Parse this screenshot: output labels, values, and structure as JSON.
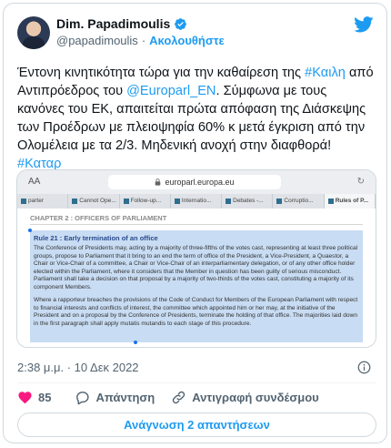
{
  "author": {
    "name": "Dim. Papadimoulis",
    "handle": "@papadimoulis",
    "separator": "·",
    "follow_label": "Ακολουθήστε"
  },
  "tweet": {
    "text_1": "Έντονη κινητικότητα τώρα για την καθαίρεση της ",
    "tag_1": "#Καιλη",
    "text_2": " από Αντιπρόεδρος του ",
    "tag_2": "@Europarl_EN",
    "text_3": ". Σύμφωνα με τους κανόνες του ΕΚ, απαιτείται πρώτα απόφαση της Διάσκεψης των Προέδρων με πλειοψηφία 60% κ μετά έγκριση από την Ολομέλεια με τα 2/3. Μηδενική ανοχή στην διαφθορά! ",
    "tag_3": "#Καταρ"
  },
  "media": {
    "browser": {
      "reader_label": "AA",
      "url": "europarl.europa.eu",
      "tabs": [
        {
          "label": "parter"
        },
        {
          "label": "Cannot Ope..."
        },
        {
          "label": "Follow-up..."
        },
        {
          "label": "Internatio..."
        },
        {
          "label": "Debates -..."
        },
        {
          "label": "Corruptio..."
        },
        {
          "label": "Rules of P..."
        }
      ]
    },
    "document": {
      "chapter": "CHAPTER 2 : OFFICERS OF PARLIAMENT",
      "rule_title": "Rule 21 : Early termination of an office",
      "paragraph_1": "The Conference of Presidents may, acting by a majority of three-fifths of the votes cast, representing at least three political groups, propose to Parliament that it bring to an end the term of office of the President, a Vice-President, a Quaestor, a Chair or Vice-Chair of a committee, a Chair or Vice-Chair of an interparliamentary delegation, or of any other office holder elected within the Parliament, where it considers that the Member in question has been guilty of serious misconduct. Parliament shall take a decision on that proposal by a majority of two-thirds of the votes cast, constituting a majority of its component Members.",
      "paragraph_2": "Where a rapporteur breaches the provisions of the Code of Conduct for Members of the European Parliament with respect to financial interests and conflicts of interest, the committee which appointed him or her may, at the initiative of the President and on a proposal by the Conference of Presidents, terminate the holding of that office. The majorities laid down in the first paragraph shall apply mutatis mutandis to each stage of this procedure."
    }
  },
  "timestamp": "2:38 μ.μ. · 10 Δεκ 2022",
  "actions": {
    "like_count": "85",
    "reply_label": "Απάντηση",
    "copy_link_label": "Αντιγραφή συνδέσμου"
  },
  "read_replies_label": "Ανάγνωση 2 απαντήσεων",
  "colors": {
    "accent": "#1d9bf0",
    "like": "#f91880",
    "text_secondary": "#536471"
  },
  "icons": [
    "verified-badge-icon",
    "twitter-bird-icon",
    "info-icon",
    "heart-icon",
    "reply-icon",
    "link-icon",
    "lock-icon"
  ]
}
